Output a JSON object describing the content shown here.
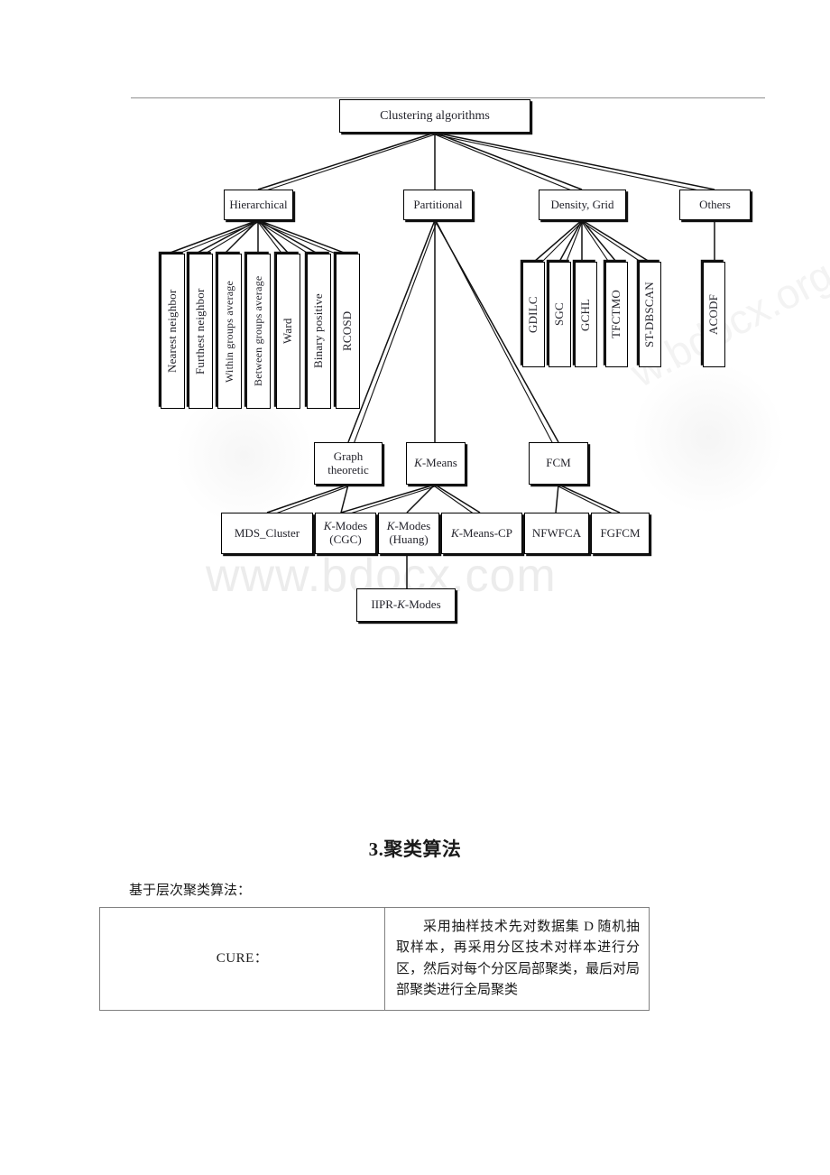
{
  "document": {
    "watermark_main": "www.bdocx.com",
    "watermark_side": "w.bdocx.org.cn"
  },
  "diagram": {
    "title": "Clustering algorithms taxonomy",
    "root": {
      "label": "Clustering algorithms"
    },
    "categories": [
      {
        "label": "Hierarchical"
      },
      {
        "label": "Partitional"
      },
      {
        "label": "Density, Grid"
      },
      {
        "label": "Others"
      }
    ],
    "hierarchical_children": [
      {
        "label": "Nearest neighbor"
      },
      {
        "label": "Furthest neighbor"
      },
      {
        "label": "Within groups average"
      },
      {
        "label": "Between groups average"
      },
      {
        "label": "Ward"
      },
      {
        "label": "Binary positive"
      },
      {
        "label": "RCOSD"
      }
    ],
    "density_grid_children": [
      {
        "label": "GDILC"
      },
      {
        "label": "SGC"
      },
      {
        "label": "GCHL"
      },
      {
        "label": "TFCTMO"
      },
      {
        "label": "ST-DBSCAN"
      }
    ],
    "others_children": [
      {
        "label": "ACODF"
      }
    ],
    "partitional_children": [
      {
        "label": "Graph theoretic",
        "line1": "Graph",
        "line2": "theoretic"
      },
      {
        "label": "K-Means",
        "italic_prefix": "K",
        "rest": "-Means"
      },
      {
        "label": "FCM"
      }
    ],
    "leaf_row": [
      {
        "label": "MDS_Cluster"
      },
      {
        "label": "K-Modes (CGC)",
        "italic_prefix": "K",
        "rest": "-Modes",
        "line2": "(CGC)"
      },
      {
        "label": "K-Modes (Huang)",
        "italic_prefix": "K",
        "rest": "-Modes",
        "line2": "(Huang)"
      },
      {
        "label": "K-Means-CP",
        "italic_prefix": "K",
        "rest": "-Means-CP"
      },
      {
        "label": "NFWFCA"
      },
      {
        "label": "FGFCM"
      }
    ],
    "deepest": {
      "label": "IIPR-K-Modes",
      "prefix": "IIPR-",
      "italic_prefix": "K",
      "rest": "-Modes"
    }
  },
  "section": {
    "heading": "3.聚类算法",
    "intro": "基于层次聚类算法："
  },
  "table": {
    "rows": [
      {
        "name": "CURE：",
        "description": "采用抽样技术先对数据集 D 随机抽取样本，再采用分区技术对样本进行分区，然后对每个分区局部聚类，最后对局部聚类进行全局聚类"
      }
    ]
  }
}
